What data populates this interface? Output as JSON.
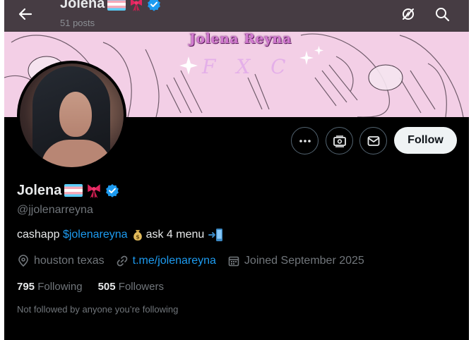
{
  "header": {
    "name": "Jolena",
    "posts": "51 posts"
  },
  "banner": {
    "title": "Jolena Reyna",
    "subtitle": "F X C"
  },
  "actions": {
    "follow_label": "Follow"
  },
  "profile": {
    "name": "Jolena",
    "handle": "@jjolenarreyna",
    "bio_prefix": "cashapp ",
    "bio_link": "$jolenareyna",
    "bio_suffix": "ask 4 menu",
    "location": "houston texas",
    "website": "t.me/jolenareyna",
    "joined": "Joined September 2025",
    "following_count": "795",
    "following_label": "Following",
    "followers_count": "505",
    "followers_label": "Followers",
    "not_followed": "Not followed by anyone you’re following"
  },
  "colors": {
    "background": "#000000",
    "accent": "#1d9bf0",
    "secondary_text": "#71767b",
    "verified": "#1d9bf0",
    "banner": "#f3cfe6"
  },
  "icons": [
    "back-arrow-icon",
    "trans-flag-icon",
    "ribbon-icon",
    "verified-badge-icon",
    "no-notifications-icon",
    "search-icon",
    "more-icon",
    "money-icon",
    "mail-icon",
    "money-bag-icon",
    "phone-arrow-icon",
    "location-icon",
    "link-icon",
    "calendar-icon"
  ]
}
